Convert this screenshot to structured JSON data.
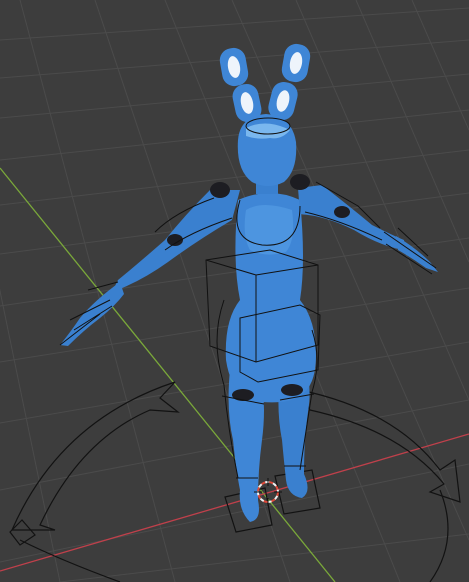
{
  "app": {
    "view": "3D Viewport"
  },
  "colors": {
    "background": "#3d3d3d",
    "grid": "#4a4a4a",
    "grid_minor": "#444444",
    "x_axis": "#c0404b",
    "y_axis": "#7aa83a",
    "mesh": "#3f86d6",
    "mesh_dark": "#2f63a8",
    "mesh_light": "#7ab7ee",
    "joint": "#1d1d22",
    "rig": "#101010",
    "cursor_red": "#e04a3a",
    "cursor_white": "#f2f2f2"
  },
  "objects": [
    {
      "name": "character-mesh",
      "kind": "mesh"
    },
    {
      "name": "armature-rig",
      "kind": "control-shapes"
    },
    {
      "name": "3d-cursor",
      "kind": "cursor"
    }
  ]
}
